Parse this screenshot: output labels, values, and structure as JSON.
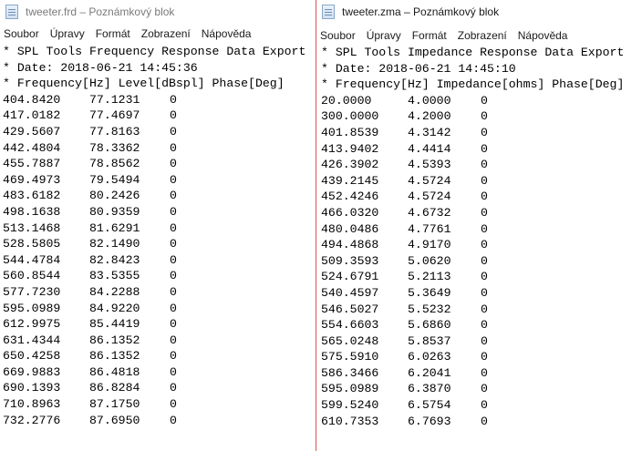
{
  "left_window": {
    "title": "tweeter.frd – Poznámkový blok",
    "menu": [
      "Soubor",
      "Úpravy",
      "Formát",
      "Zobrazení",
      "Nápověda"
    ],
    "header_lines": [
      "* SPL Tools Frequency Response Data Export",
      "* Date: 2018-06-21 14:45:36",
      "* Frequency[Hz] Level[dBspl] Phase[Deg]"
    ],
    "rows": [
      [
        "404.8420",
        "77.1231",
        "0"
      ],
      [
        "417.0182",
        "77.4697",
        "0"
      ],
      [
        "429.5607",
        "77.8163",
        "0"
      ],
      [
        "442.4804",
        "78.3362",
        "0"
      ],
      [
        "455.7887",
        "78.8562",
        "0"
      ],
      [
        "469.4973",
        "79.5494",
        "0"
      ],
      [
        "483.6182",
        "80.2426",
        "0"
      ],
      [
        "498.1638",
        "80.9359",
        "0"
      ],
      [
        "513.1468",
        "81.6291",
        "0"
      ],
      [
        "528.5805",
        "82.1490",
        "0"
      ],
      [
        "544.4784",
        "82.8423",
        "0"
      ],
      [
        "560.8544",
        "83.5355",
        "0"
      ],
      [
        "577.7230",
        "84.2288",
        "0"
      ],
      [
        "595.0989",
        "84.9220",
        "0"
      ],
      [
        "612.9975",
        "85.4419",
        "0"
      ],
      [
        "631.4344",
        "86.1352",
        "0"
      ],
      [
        "650.4258",
        "86.1352",
        "0"
      ],
      [
        "669.9883",
        "86.4818",
        "0"
      ],
      [
        "690.1393",
        "86.8284",
        "0"
      ],
      [
        "710.8963",
        "87.1750",
        "0"
      ],
      [
        "732.2776",
        "87.6950",
        "0"
      ]
    ]
  },
  "right_window": {
    "title": "tweeter.zma – Poznámkový blok",
    "menu": [
      "Soubor",
      "Úpravy",
      "Formát",
      "Zobrazení",
      "Nápověda"
    ],
    "header_lines": [
      "* SPL Tools Impedance Response Data Export",
      "* Date: 2018-06-21 14:45:10",
      "* Frequency[Hz] Impedance[ohms] Phase[Deg]"
    ],
    "rows": [
      [
        "20.0000",
        "4.0000",
        "0"
      ],
      [
        "300.0000",
        "4.2000",
        "0"
      ],
      [
        "401.8539",
        "4.3142",
        "0"
      ],
      [
        "413.9402",
        "4.4414",
        "0"
      ],
      [
        "426.3902",
        "4.5393",
        "0"
      ],
      [
        "439.2145",
        "4.5724",
        "0"
      ],
      [
        "452.4246",
        "4.5724",
        "0"
      ],
      [
        "466.0320",
        "4.6732",
        "0"
      ],
      [
        "480.0486",
        "4.7761",
        "0"
      ],
      [
        "494.4868",
        "4.9170",
        "0"
      ],
      [
        "509.3593",
        "5.0620",
        "0"
      ],
      [
        "524.6791",
        "5.2113",
        "0"
      ],
      [
        "540.4597",
        "5.3649",
        "0"
      ],
      [
        "546.5027",
        "5.5232",
        "0"
      ],
      [
        "554.6603",
        "5.6860",
        "0"
      ],
      [
        "565.0248",
        "5.8537",
        "0"
      ],
      [
        "575.5910",
        "6.0263",
        "0"
      ],
      [
        "586.3466",
        "6.2041",
        "0"
      ],
      [
        "595.0989",
        "6.3870",
        "0"
      ],
      [
        "599.5240",
        "6.5754",
        "0"
      ],
      [
        "610.7353",
        "6.7693",
        "0"
      ]
    ]
  },
  "colors": {
    "active_border": "#e0524a",
    "inactive_title": "#7a7a7a"
  },
  "icons": {
    "app": "notepad-icon"
  }
}
